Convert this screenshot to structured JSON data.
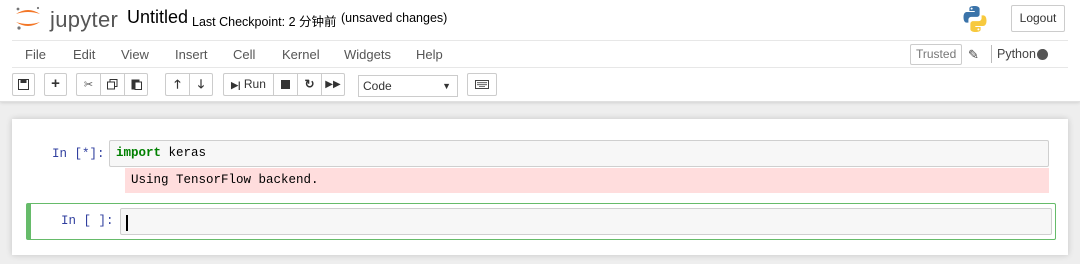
{
  "header": {
    "logo_text": "jupyter",
    "notebook_name": "Untitled",
    "checkpoint": "Last Checkpoint: 2 分钟前",
    "unsaved": "(unsaved changes)",
    "logout_label": "Logout"
  },
  "menubar": {
    "items": [
      "File",
      "Edit",
      "View",
      "Insert",
      "Cell",
      "Kernel",
      "Widgets",
      "Help"
    ],
    "trusted_label": "Trusted",
    "kernel_name": "Python 3"
  },
  "toolbar": {
    "run_label": "Run",
    "cell_type": "Code",
    "icons": [
      "save-icon",
      "plus-icon",
      "scissors-icon",
      "copy-icon",
      "paste-icon",
      "arrow-up-icon",
      "arrow-down-icon",
      "step-forward-icon",
      "stop-icon",
      "restart-icon",
      "fast-forward-icon",
      "keyboard-icon"
    ]
  },
  "cells": [
    {
      "prompt": "In [*]:",
      "keyword": "import",
      "code_rest": " keras",
      "output": "Using TensorFlow backend."
    },
    {
      "prompt": "In [ ]:",
      "code": ""
    }
  ],
  "colors": {
    "accent_orange": "#f37626",
    "prompt_blue": "#303f9f",
    "selected_green": "#66bb6a",
    "stderr_bg": "#ffdddd"
  }
}
